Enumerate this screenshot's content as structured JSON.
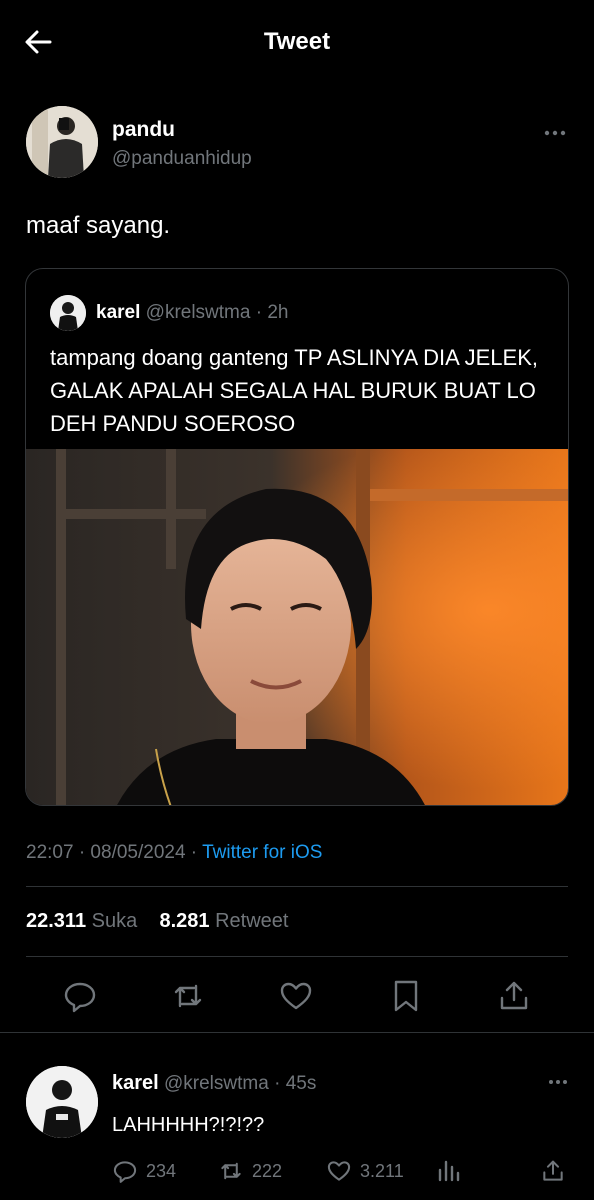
{
  "header": {
    "title": "Tweet",
    "back_icon": "arrow-left-icon"
  },
  "tweet": {
    "author_name": "pandu",
    "author_handle": "@panduanhidup",
    "text": "maaf sayang.",
    "timestamp": "22:07 · 08/05/2024 · ",
    "source": "Twitter for iOS",
    "likes_count": "22.311",
    "likes_label": "Suka",
    "retweets_count": "8.281",
    "retweets_label": "Retweet",
    "more_icon": "ellipsis-icon"
  },
  "quoted": {
    "author_name": "karel",
    "author_handle": "@krelswtma",
    "separator": " · ",
    "time": "2h",
    "text": "tampang doang ganteng TP ASLINYA DIA JELEK, GALAK APALAH SEGALA HAL BURUK BUAT LO DEH PANDU SOEROSO"
  },
  "actions": [
    "reply-icon",
    "retweet-icon",
    "like-icon",
    "bookmark-icon",
    "share-icon"
  ],
  "reply": {
    "author_name": "karel",
    "author_handle": "@krelswtma",
    "separator": " · ",
    "time": "45s",
    "text": "LAHHHHH?!?!??",
    "reply_count": "234",
    "retweet_count": "222",
    "like_count": "3.211",
    "more_icon": "ellipsis-icon"
  },
  "colors": {
    "background": "#000000",
    "text": "#e7e9ea",
    "secondary": "#71767b",
    "accent": "#1d9bf0",
    "border": "#2f3336"
  }
}
